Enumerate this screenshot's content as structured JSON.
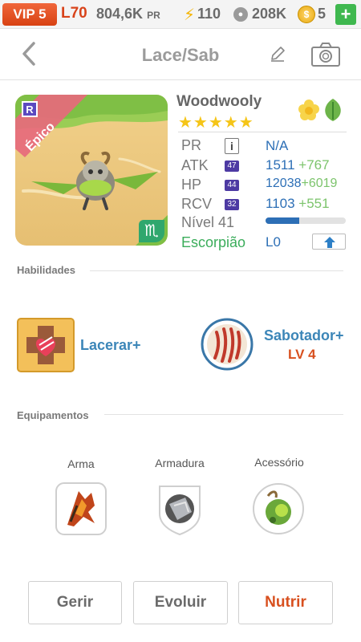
{
  "status_bar": {
    "vip": "VIP 5",
    "level": "L70",
    "power": "804,6K",
    "power_unit": "PR",
    "energy": "110",
    "paw_points": "208K",
    "coins": "5",
    "add_label": "+"
  },
  "header": {
    "title": "Lace/Sab"
  },
  "monster": {
    "name": "Woodwooly",
    "rarity_label": "Épico",
    "r_badge": "R",
    "stars": "★★★★★",
    "stats": {
      "pr_label": "PR",
      "pr_badge": "i",
      "pr_value": "N/A",
      "atk_label": "ATK",
      "atk_badge": "47",
      "atk_value": "1511",
      "atk_bonus": "+767",
      "hp_label": "HP",
      "hp_badge": "44",
      "hp_value": "12038",
      "hp_bonus": "+6019",
      "rcv_label": "RCV",
      "rcv_badge": "32",
      "rcv_value": "1103",
      "rcv_bonus": "+551"
    },
    "level_label": "Nível 41",
    "level_progress": 0.42,
    "zodiac_label": "Escorpião",
    "zodiac_level": "L0",
    "zodiac_symbol": "♏"
  },
  "skills": {
    "section_label": "Habilidades",
    "items": [
      {
        "name": "Lacerar+",
        "level": ""
      },
      {
        "name": "Sabotador+",
        "level": "LV 4"
      }
    ]
  },
  "equipment": {
    "section_label": "Equipamentos",
    "slots": [
      {
        "label": "Arma"
      },
      {
        "label": "Armadura"
      },
      {
        "label": "Acessório"
      }
    ]
  },
  "actions": {
    "manage": "Gerir",
    "evolve": "Evoluir",
    "feed": "Nutrir"
  },
  "colors": {
    "accent_orange": "#d8501f",
    "stat_blue": "#2d6fb6",
    "bonus_green": "#7cc46c",
    "zodiac_green": "#3bad5b",
    "stat_badge_purple": "#4d3aa3"
  }
}
